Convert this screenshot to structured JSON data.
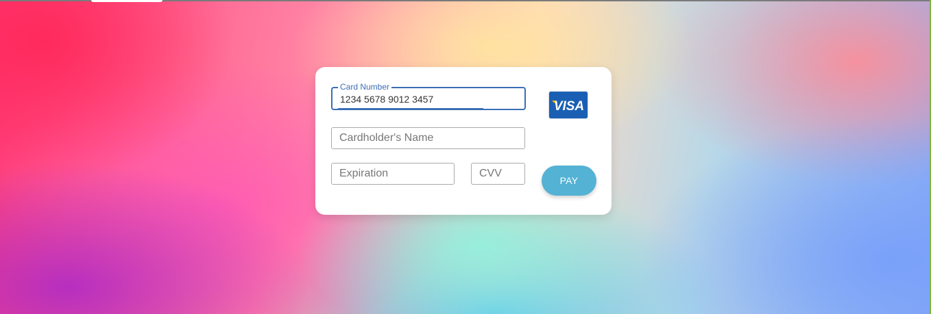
{
  "payment_form": {
    "card_number": {
      "label": "Card Number",
      "value": "1234 5678 9012 3457"
    },
    "cardholder_name": {
      "placeholder": "Cardholder's Name"
    },
    "expiration": {
      "placeholder": "Expiration"
    },
    "cvv": {
      "placeholder": "CVV"
    },
    "card_brand": {
      "text": "VISA",
      "background_color": "#1a5fb4",
      "accent_color": "#f7b600"
    },
    "pay_button": {
      "label": "PAY",
      "color": "#54b2d4"
    }
  }
}
